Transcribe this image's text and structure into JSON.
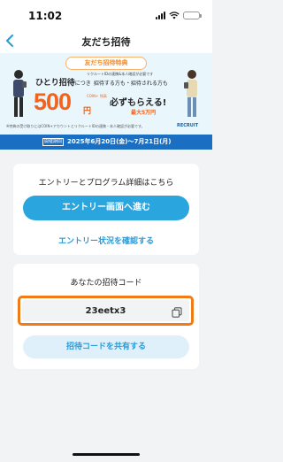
{
  "status": {
    "time": "11:02",
    "battery_level": 0.9
  },
  "nav": {
    "back_icon": "chevron-left-icon",
    "title": "友だち招待"
  },
  "banner": {
    "tag": "友だち招待特典",
    "note": "リクルートIDの連携&本人確認が必要です",
    "lead_prefix": "ひとり招待",
    "lead_connector": "につき",
    "lead_suffix": "招待する方も・招待される方も",
    "amount": "500",
    "yen": "円",
    "coin_label": "COIN+ 残高",
    "must": "必ずもらえる!",
    "max": "最大5万円",
    "footnote": "※特典の受け取りにはCOIN+アカウントとリクルートIDの連携・本人確認が必要です。",
    "brand": "RECRUIT"
  },
  "period": {
    "badge": "開催期間",
    "text": "2025年6月20日(金)〜7月21日(月)"
  },
  "entry_card": {
    "title": "エントリーとプログラム詳細はこちら",
    "primary_button": "エントリー画面へ進む",
    "status_link": "エントリー状況を確認する"
  },
  "code_card": {
    "title": "あなたの招待コード",
    "code": "23eetx3",
    "copy_icon": "copy-icon",
    "share_button": "招待コードを共有する"
  },
  "colors": {
    "accent": "#2aa5de",
    "highlight": "#ef7b19",
    "period_bar": "#1b6fc2",
    "promo": "#f0641f"
  }
}
